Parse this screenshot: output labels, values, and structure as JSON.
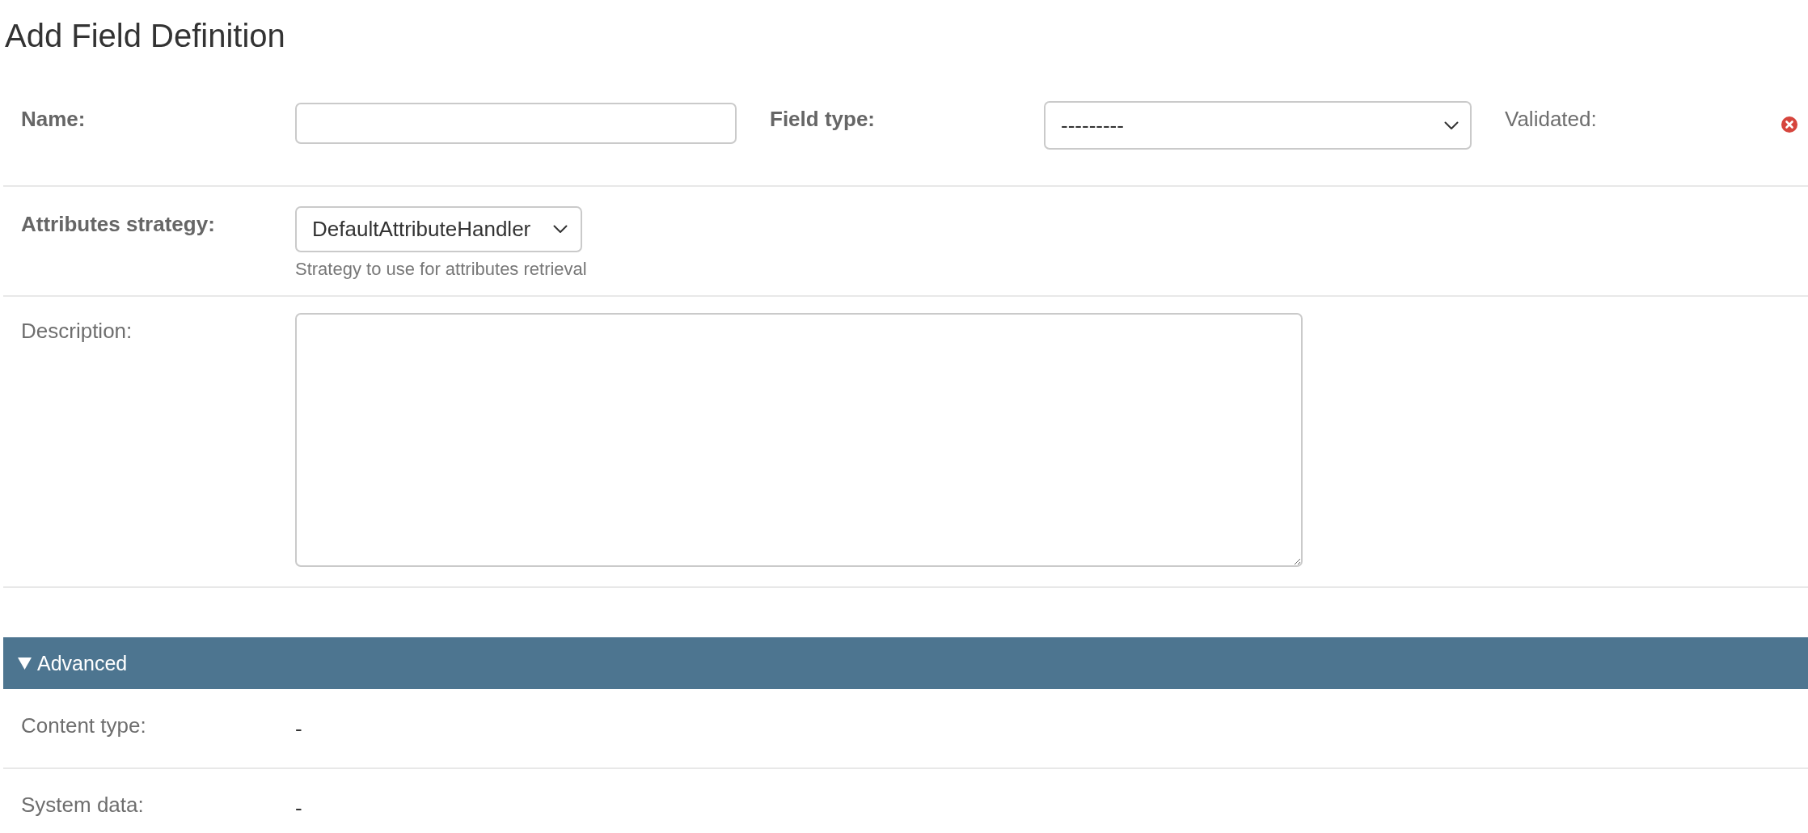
{
  "page": {
    "title": "Add Field Definition"
  },
  "form_rows": [
    {
      "fields": [
        {
          "label": "Name:",
          "required": true,
          "kind": "text"
        },
        {
          "label": "Field type:",
          "required": true,
          "kind": "select",
          "value": "---------"
        },
        {
          "label": "Validated:",
          "required": false,
          "kind": "boolean",
          "checked": false
        }
      ]
    },
    {
      "fields": [
        {
          "label": "Attributes strategy:",
          "required": true,
          "kind": "select",
          "value": "DefaultAttributeHandler",
          "help": "Strategy to use for attributes retrieval"
        }
      ]
    },
    {
      "fields": [
        {
          "label": "Description:",
          "required": false,
          "kind": "textarea"
        }
      ]
    }
  ],
  "advanced": {
    "title": "Advanced",
    "expanded": true,
    "rows": [
      {
        "label": "Content type:",
        "value": "-"
      },
      {
        "label": "System data:",
        "value": "-"
      }
    ]
  }
}
